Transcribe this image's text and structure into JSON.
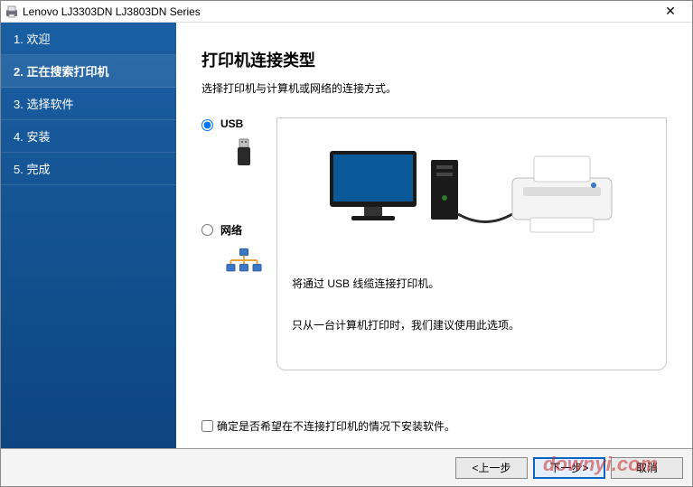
{
  "window": {
    "title": "Lenovo LJ3303DN LJ3803DN Series"
  },
  "sidebar": {
    "steps": [
      {
        "label": "1. 欢迎"
      },
      {
        "label": "2. 正在搜索打印机"
      },
      {
        "label": "3. 选择软件"
      },
      {
        "label": "4. 安装"
      },
      {
        "label": "5. 完成"
      }
    ]
  },
  "main": {
    "heading": "打印机连接类型",
    "subheading": "选择打印机与计算机或网络的连接方式。",
    "options": {
      "usb": {
        "label": "USB"
      },
      "network": {
        "label": "网络"
      }
    },
    "description": {
      "line1": "将通过 USB 线缆连接打印机。",
      "line2": "只从一台计算机打印时，我们建议使用此选项。"
    },
    "checkbox": "确定是否希望在不连接打印机的情况下安装软件。"
  },
  "footer": {
    "back": "<上一步",
    "next": "下一步>",
    "cancel": "取消"
  },
  "watermark": "downyi.com"
}
